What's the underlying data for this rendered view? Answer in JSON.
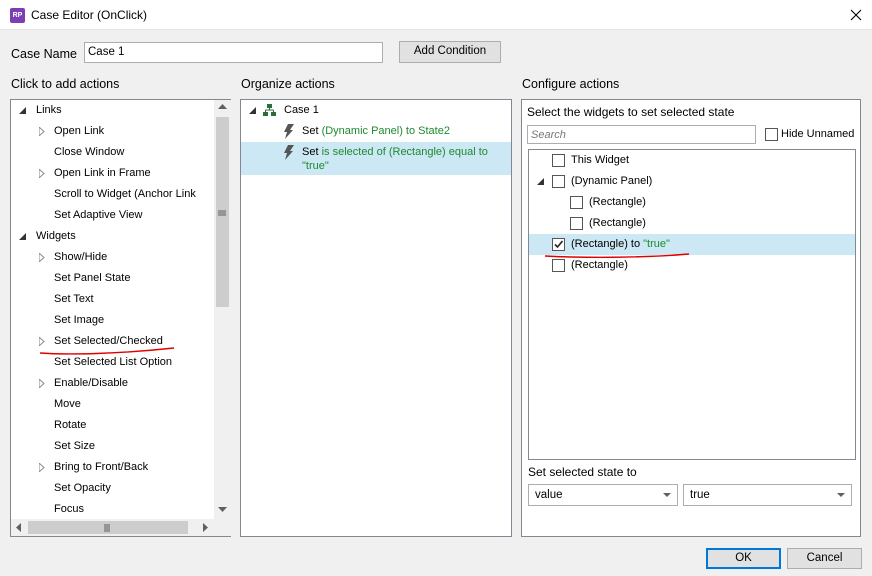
{
  "window": {
    "title": "Case Editor (OnClick)",
    "app_icon_text": "RP"
  },
  "case_name": {
    "label": "Case Name",
    "value": "Case 1"
  },
  "add_condition_label": "Add Condition",
  "left_panel": {
    "header": "Click to add actions",
    "items": [
      {
        "label": "Links",
        "level": 0,
        "expander": "expanded"
      },
      {
        "label": "Open Link",
        "level": 1,
        "expander": "collapsed"
      },
      {
        "label": "Close Window",
        "level": 1,
        "expander": "none"
      },
      {
        "label": "Open Link in Frame",
        "level": 1,
        "expander": "collapsed"
      },
      {
        "label": "Scroll to Widget (Anchor Link",
        "level": 1,
        "expander": "none"
      },
      {
        "label": "Set Adaptive View",
        "level": 1,
        "expander": "none"
      },
      {
        "label": "Widgets",
        "level": 0,
        "expander": "expanded"
      },
      {
        "label": "Show/Hide",
        "level": 1,
        "expander": "collapsed"
      },
      {
        "label": "Set Panel State",
        "level": 1,
        "expander": "none"
      },
      {
        "label": "Set Text",
        "level": 1,
        "expander": "none"
      },
      {
        "label": "Set Image",
        "level": 1,
        "expander": "none"
      },
      {
        "label": "Set Selected/Checked",
        "level": 1,
        "expander": "collapsed"
      },
      {
        "label": "Set Selected List Option",
        "level": 1,
        "expander": "none"
      },
      {
        "label": "Enable/Disable",
        "level": 1,
        "expander": "collapsed"
      },
      {
        "label": "Move",
        "level": 1,
        "expander": "none"
      },
      {
        "label": "Rotate",
        "level": 1,
        "expander": "none"
      },
      {
        "label": "Set Size",
        "level": 1,
        "expander": "none"
      },
      {
        "label": "Bring to Front/Back",
        "level": 1,
        "expander": "collapsed"
      },
      {
        "label": "Set Opacity",
        "level": 1,
        "expander": "none"
      },
      {
        "label": "Focus",
        "level": 1,
        "expander": "none"
      }
    ]
  },
  "middle_panel": {
    "header": "Organize actions",
    "case_label": "Case 1",
    "actions": [
      {
        "set": "Set",
        "rest": "(Dynamic Panel) to State2",
        "selected": false
      },
      {
        "set": "Set",
        "rest": "is selected of (Rectangle) equal to",
        "rest2": "\"true\"",
        "selected": true
      }
    ]
  },
  "right_panel": {
    "header": "Configure actions",
    "subheader": "Select the widgets to set selected state",
    "search_placeholder": "Search",
    "hide_unnamed_label": "Hide Unnamed",
    "widgets": [
      {
        "label": "This Widget",
        "suffix": "",
        "checked": false,
        "indent": 0,
        "expander": "none",
        "selected": false
      },
      {
        "label": "(Dynamic Panel)",
        "suffix": "",
        "checked": false,
        "indent": 0,
        "expander": "expanded",
        "selected": false
      },
      {
        "label": "(Rectangle)",
        "suffix": "",
        "checked": false,
        "indent": 1,
        "expander": "none",
        "selected": false
      },
      {
        "label": "(Rectangle)",
        "suffix": "",
        "checked": false,
        "indent": 1,
        "expander": "none",
        "selected": false
      },
      {
        "label": "(Rectangle) to ",
        "suffix": "\"true\"",
        "checked": true,
        "indent": 0,
        "expander": "none",
        "selected": true
      },
      {
        "label": "(Rectangle)",
        "suffix": "",
        "checked": false,
        "indent": 0,
        "expander": "none",
        "selected": false
      }
    ],
    "set_state_label": "Set selected state to",
    "value_select": "value",
    "true_select": "true"
  },
  "ok_label": "OK",
  "cancel_label": "Cancel",
  "colors": {
    "accent": "#0078d7",
    "selection": "#cce8f4",
    "action_green": "#1e8a2e",
    "annotation_red": "#e00000"
  }
}
